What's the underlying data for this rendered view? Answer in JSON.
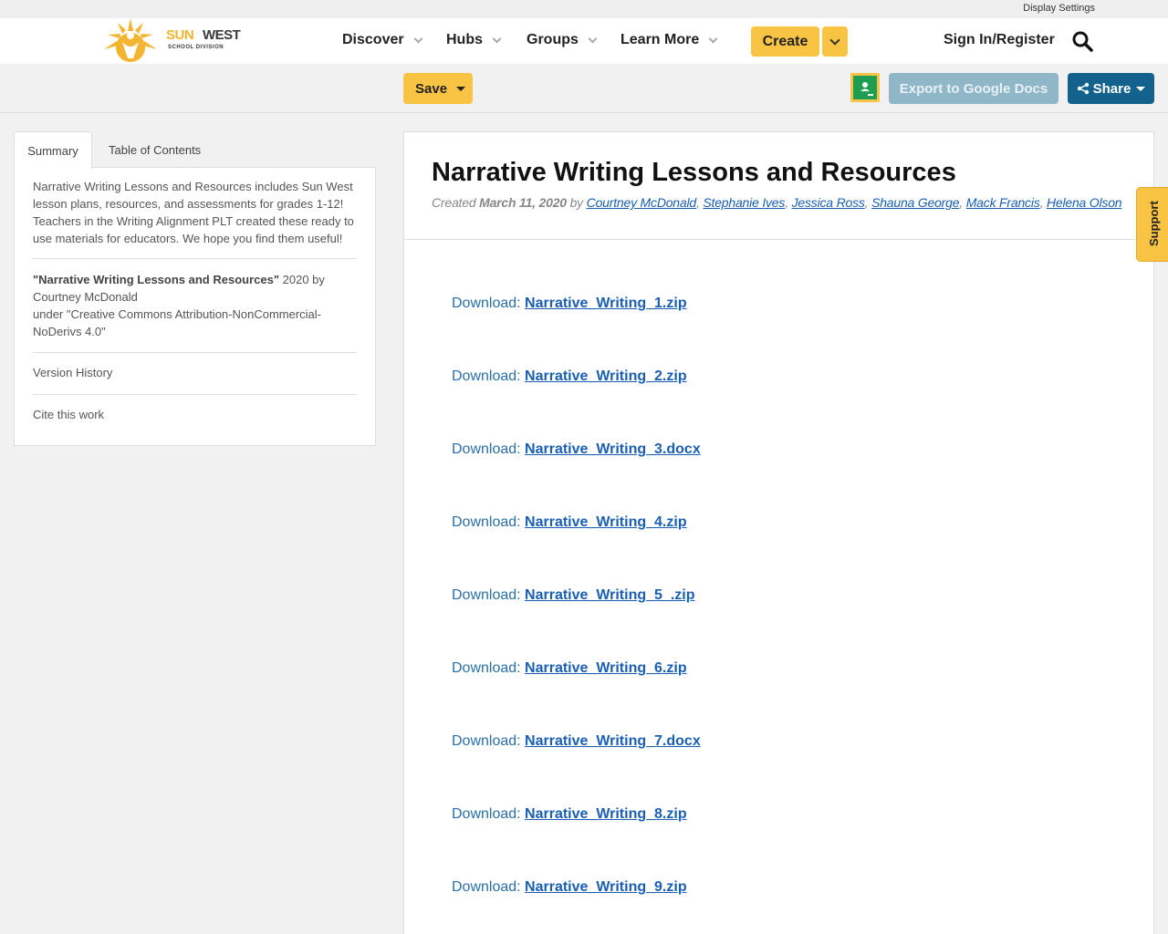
{
  "utility": {
    "display_settings": "Display Settings"
  },
  "logo": {
    "sun": "SUN",
    "west": "WEST",
    "sub": "SCHOOL DIVISION"
  },
  "nav": {
    "items": [
      {
        "label": "Discover"
      },
      {
        "label": "Hubs"
      },
      {
        "label": "Groups"
      },
      {
        "label": "Learn More"
      }
    ],
    "create_label": "Create",
    "signin_label": "Sign In/Register"
  },
  "toolbar": {
    "save_label": "Save",
    "export_label": "Export to Google Docs",
    "share_label": "Share"
  },
  "sidebar": {
    "tabs": [
      {
        "label": "Summary"
      },
      {
        "label": "Table of Contents"
      }
    ],
    "description": "Narrative Writing Lessons and Resources includes Sun West lesson plans, resources, and assessments for grades 1-12! Teachers in the Writing Alignment PLT created these ready to use materials for educators. We hope you find them useful!",
    "license_title": "\"Narrative Writing Lessons and Resources\"",
    "license_by": " 2020 by Courtney McDonald",
    "license_under": "under \"Creative Commons Attribution-NonCommercial-NoDerivs 4.0\"",
    "version_history": "Version History",
    "cite": "Cite this work"
  },
  "content": {
    "title": "Narrative Writing Lessons and Resources",
    "created_prefix": "Created ",
    "created_date": "March 11, 2020",
    "by": " by ",
    "authors": [
      "Courtney McDonald",
      "Stephanie Ives",
      "Jessica Ross",
      "Shauna George",
      "Mack Francis",
      "Helena Olson"
    ],
    "download_prefix": "Download: ",
    "downloads": [
      "Narrative_Writing_1.zip",
      "Narrative_Writing_2.zip",
      "Narrative_Writing_3.docx",
      "Narrative_Writing_4.zip",
      "Narrative_Writing_5_.zip",
      "Narrative_Writing_6.zip",
      "Narrative_Writing_7.docx",
      "Narrative_Writing_8.zip",
      "Narrative_Writing_9.zip"
    ]
  },
  "support": {
    "label": "Support"
  },
  "colors": {
    "brand_yellow": "#f9c443",
    "share_blue": "#13628e",
    "link_blue": "#1a5fb4"
  }
}
